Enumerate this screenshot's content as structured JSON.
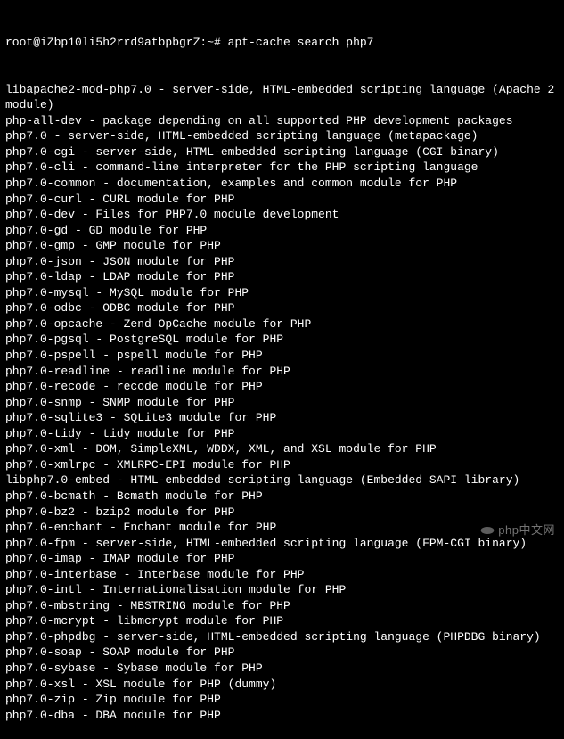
{
  "prompt": "root@iZbp10li5h2rrd9atbpbgrZ:~# apt-cache search php7",
  "lines": [
    "libapache2-mod-php7.0 - server-side, HTML-embedded scripting language (Apache 2 module)",
    "php-all-dev - package depending on all supported PHP development packages",
    "php7.0 - server-side, HTML-embedded scripting language (metapackage)",
    "php7.0-cgi - server-side, HTML-embedded scripting language (CGI binary)",
    "php7.0-cli - command-line interpreter for the PHP scripting language",
    "php7.0-common - documentation, examples and common module for PHP",
    "php7.0-curl - CURL module for PHP",
    "php7.0-dev - Files for PHP7.0 module development",
    "php7.0-gd - GD module for PHP",
    "php7.0-gmp - GMP module for PHP",
    "php7.0-json - JSON module for PHP",
    "php7.0-ldap - LDAP module for PHP",
    "php7.0-mysql - MySQL module for PHP",
    "php7.0-odbc - ODBC module for PHP",
    "php7.0-opcache - Zend OpCache module for PHP",
    "php7.0-pgsql - PostgreSQL module for PHP",
    "php7.0-pspell - pspell module for PHP",
    "php7.0-readline - readline module for PHP",
    "php7.0-recode - recode module for PHP",
    "php7.0-snmp - SNMP module for PHP",
    "php7.0-sqlite3 - SQLite3 module for PHP",
    "php7.0-tidy - tidy module for PHP",
    "php7.0-xml - DOM, SimpleXML, WDDX, XML, and XSL module for PHP",
    "php7.0-xmlrpc - XMLRPC-EPI module for PHP",
    "libphp7.0-embed - HTML-embedded scripting language (Embedded SAPI library)",
    "php7.0-bcmath - Bcmath module for PHP",
    "php7.0-bz2 - bzip2 module for PHP",
    "php7.0-enchant - Enchant module for PHP",
    "php7.0-fpm - server-side, HTML-embedded scripting language (FPM-CGI binary)",
    "php7.0-imap - IMAP module for PHP",
    "php7.0-interbase - Interbase module for PHP",
    "php7.0-intl - Internationalisation module for PHP",
    "php7.0-mbstring - MBSTRING module for PHP",
    "php7.0-mcrypt - libmcrypt module for PHP",
    "php7.0-phpdbg - server-side, HTML-embedded scripting language (PHPDBG binary)",
    "php7.0-soap - SOAP module for PHP",
    "php7.0-sybase - Sybase module for PHP",
    "php7.0-xsl - XSL module for PHP (dummy)",
    "php7.0-zip - Zip module for PHP",
    "php7.0-dba - DBA module for PHP"
  ],
  "watermark": "php中文网"
}
